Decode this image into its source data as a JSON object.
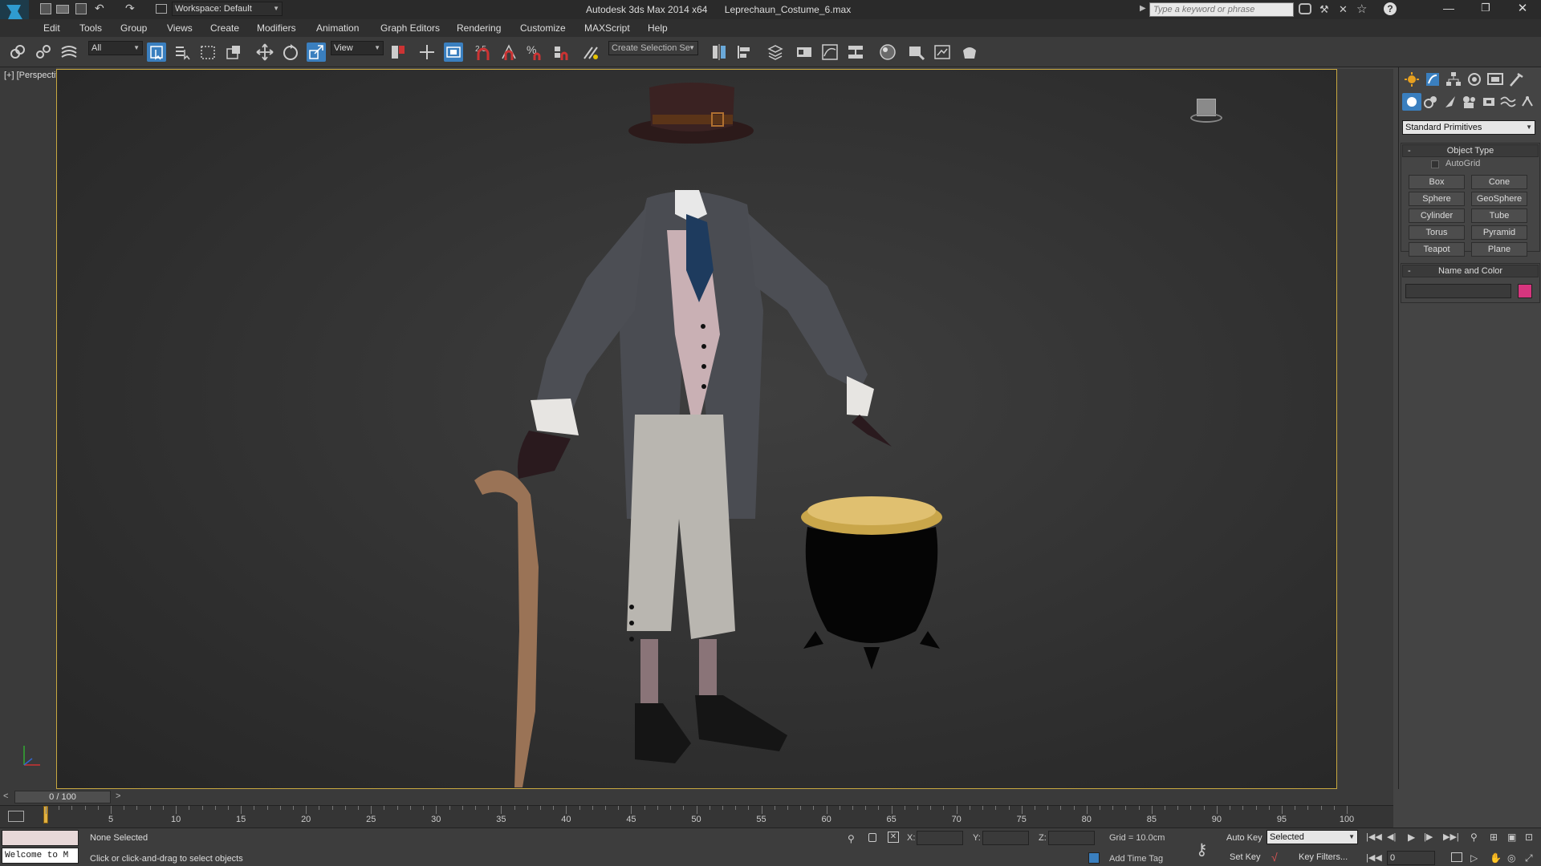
{
  "titlebar": {
    "workspace": "Workspace: Default",
    "title": "Autodesk 3ds Max  2014 x64",
    "filename": "Leprechaun_Costume_6.max",
    "search_placeholder": "Type a keyword or phrase"
  },
  "menu": [
    "Edit",
    "Tools",
    "Group",
    "Views",
    "Create",
    "Modifiers",
    "Animation",
    "Graph Editors",
    "Rendering",
    "Customize",
    "MAXScript",
    "Help"
  ],
  "toolbar": {
    "filter_value": "All",
    "refcoord_value": "View",
    "selection_set_placeholder": "Create Selection Se",
    "snap_label": "2.5"
  },
  "viewport": {
    "label": "[+] [Perspective ] [Shaded ]"
  },
  "command_panel": {
    "category": "Standard Primitives",
    "object_type_title": "Object Type",
    "autogrid_label": "AutoGrid",
    "buttons": [
      "Box",
      "Cone",
      "Sphere",
      "GeoSphere",
      "Cylinder",
      "Tube",
      "Torus",
      "Pyramid",
      "Teapot",
      "Plane"
    ],
    "name_color_title": "Name and Color",
    "color_swatch": "#d6357e"
  },
  "timeline": {
    "frame_label": "0 / 100",
    "ticks": [
      "5",
      "10",
      "15",
      "20",
      "25",
      "30",
      "35",
      "40",
      "45",
      "50",
      "55",
      "60",
      "65",
      "70",
      "75",
      "80",
      "85",
      "90",
      "95",
      "100"
    ]
  },
  "status": {
    "maxscript_listener": "Welcome to M",
    "selection": "None Selected",
    "prompt": "Click or click-and-drag to select objects",
    "x_label": "X:",
    "y_label": "Y:",
    "z_label": "Z:",
    "grid": "Grid = 10.0cm",
    "add_time_tag": "Add Time Tag",
    "auto_key": "Auto Key",
    "set_key": "Set Key",
    "selected_value": "Selected",
    "key_filters": "Key Filters...",
    "current_frame": "0"
  },
  "colors": {
    "accent": "#3a7fbf",
    "viewport_border": "#c8a840"
  }
}
